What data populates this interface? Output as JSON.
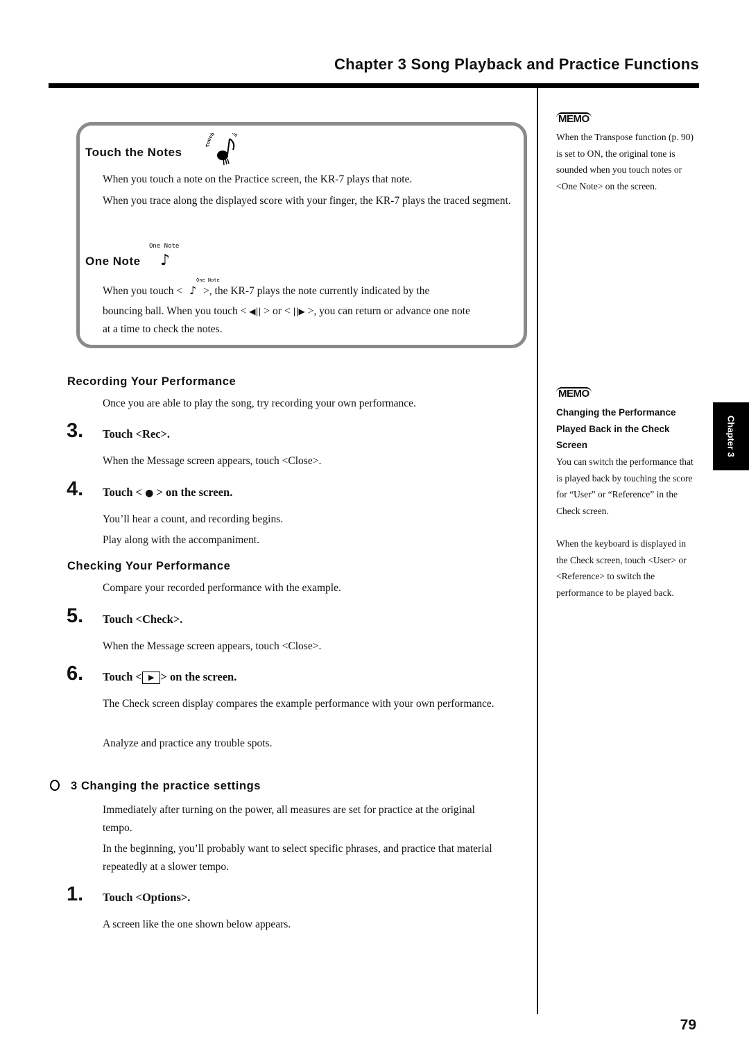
{
  "header": {
    "chapter_title": "Chapter 3 Song Playback and Practice Functions"
  },
  "feature_box": {
    "touch_notes": {
      "heading": "Touch the Notes",
      "icon": "touch-the-notes-icon",
      "icon_text": "Touch the Notes",
      "paragraphs": [
        "When you touch a note on the Practice screen, the KR-7 plays that note.",
        "When you trace along the displayed score with your finger, the KR-7 plays the traced segment."
      ]
    },
    "one_note": {
      "heading": "One Note",
      "icon_label": "One Note",
      "icon": "eighth-note-icon",
      "line1_prefix": "When you touch <",
      "line1_suffix": ">, the KR-7 plays the note currently indicated by the",
      "line2_prefix": "bouncing ball. When you touch <",
      "line2_mid": "> or <",
      "line2_suffix": ">, you can return or advance one note",
      "line3": "at a time to check the notes.",
      "back_icon": "◀||",
      "forward_icon": "||▶"
    }
  },
  "recording": {
    "heading": "Recording Your Performance",
    "intro": "Once you are able to play the song, try recording your own performance.",
    "steps": [
      {
        "num": "3.",
        "text": "Touch <Rec>.",
        "detail": [
          "When the Message screen appears, touch <Close>."
        ]
      },
      {
        "num": "4.",
        "text_prefix": "Touch <",
        "icon": "●",
        "text_suffix": "> on the screen.",
        "detail": [
          "You’ll hear a count, and recording begins.",
          "Play along with the accompaniment."
        ]
      }
    ]
  },
  "checking": {
    "heading": "Checking Your Performance",
    "intro": "Compare your recorded performance with the example.",
    "steps": [
      {
        "num": "5.",
        "text": "Touch <Check>.",
        "detail": [
          "When the Message screen appears, touch <Close>."
        ]
      },
      {
        "num": "6.",
        "text_prefix": "Touch <",
        "icon": "▶",
        "text_suffix": "> on the screen.",
        "detail": [
          "The Check screen display compares the example performance with your own performance.",
          "Analyze and practice any trouble spots."
        ]
      }
    ]
  },
  "changing": {
    "heading": "3 Changing the practice settings",
    "paragraphs": [
      "Immediately after turning on the power, all measures are set for practice at the original tempo.",
      "In the beginning, you’ll probably want to select specific phrases, and practice that material repeatedly at a slower tempo."
    ],
    "step": {
      "num": "1.",
      "text": "Touch <Options>.",
      "detail": "A screen like the one shown below appears."
    }
  },
  "sidebar": {
    "memo_label": "MEMO",
    "memo1": "When the Transpose function (p. 90) is set to ON, the original tone is sounded when you touch notes or <One Note> on the screen.",
    "memo2_title": "Changing the Performance Played Back in the Check Screen",
    "memo2_body": "You can switch the performance that is played back by touching the score for “User” or “Reference” in the Check screen.",
    "memo2_body2": "When the keyboard is displayed in the Check screen, touch <User> or <Reference> to switch the performance to be played back."
  },
  "chapter_tab": "Chapter 3",
  "page_number": "79"
}
